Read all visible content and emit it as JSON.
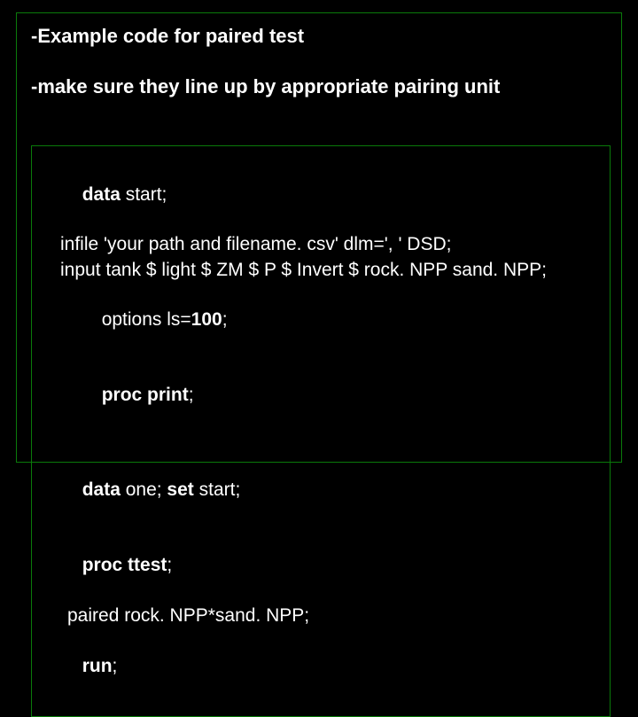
{
  "slide": {
    "heading1": "-Example code for paired test",
    "heading2": "-make sure they line up by appropriate pairing unit",
    "code": {
      "l1a": "data",
      "l1b": " start;",
      "l2": "infile 'your path and filename. csv' dlm=', ' DSD;",
      "l3": "input tank $ light $ ZM $ P $ Invert $ rock. NPP sand. NPP;",
      "l4a": "options ls=",
      "l4b": "100",
      "l4c": ";",
      "l5a": "proc print",
      "l5b": ";",
      "l6a": "data",
      "l6b": " one; ",
      "l6c": "set",
      "l6d": " start;",
      "l7a": "proc ttest",
      "l7b": ";",
      "l8": "paired rock. NPP*sand. NPP;",
      "l9a": "run",
      "l9b": ";"
    }
  }
}
